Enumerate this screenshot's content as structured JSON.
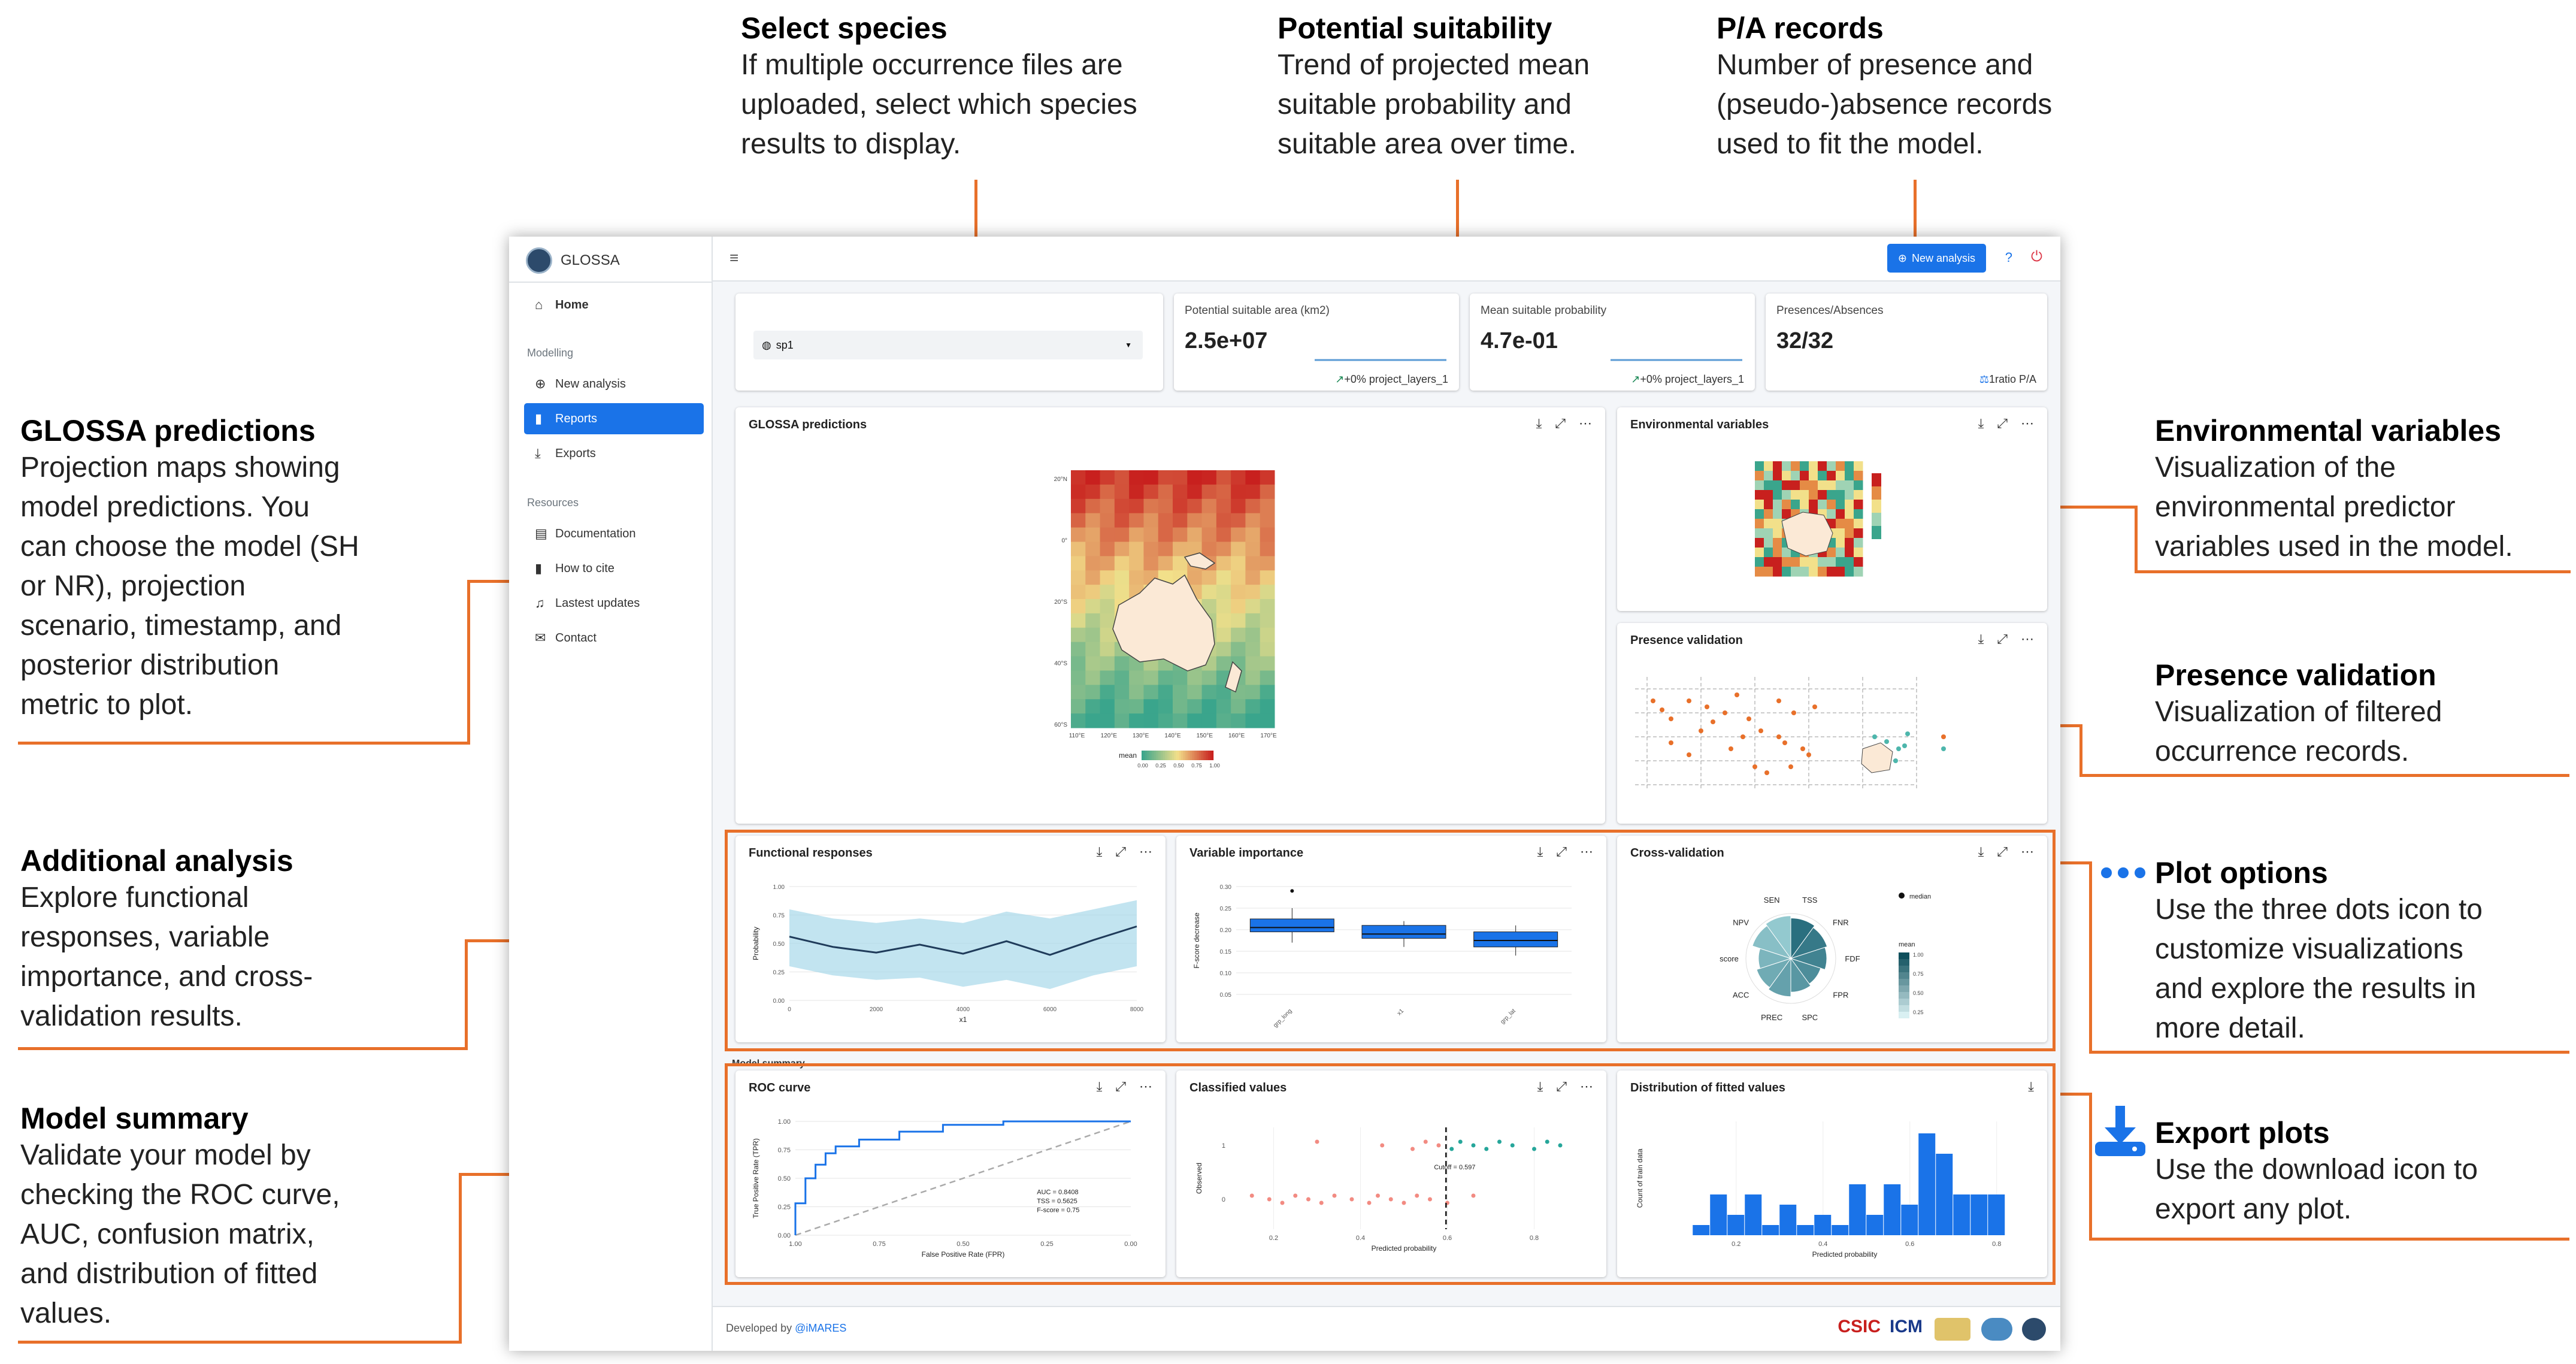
{
  "annotations": {
    "select_species": {
      "title": "Select species",
      "lines": [
        "If multiple occurrence files are",
        "uploaded, select which species",
        "results to display."
      ]
    },
    "potential_suitability": {
      "title": "Potential suitability",
      "lines": [
        "Trend of projected mean",
        "suitable probability and",
        "suitable area over time."
      ]
    },
    "pa_records": {
      "title": "P/A records",
      "lines": [
        "Number of presence and",
        "(pseudo-)absence records",
        "used to fit the model."
      ]
    },
    "glossa_predictions": {
      "title": "GLOSSA predictions",
      "lines": [
        "Projection maps showing",
        "model predictions. You",
        "can choose the model (SH",
        "or NR), projection",
        "scenario, timestamp, and",
        "posterior distribution",
        "metric to plot."
      ]
    },
    "environmental_variables": {
      "title": "Environmental variables",
      "lines": [
        "Visualization of the",
        "environmental predictor",
        "variables used in the model."
      ]
    },
    "presence_validation": {
      "title": "Presence validation",
      "lines": [
        "Visualization of filtered",
        "occurrence records."
      ]
    },
    "additional_analysis": {
      "title": "Additional analysis",
      "lines": [
        "Explore functional",
        "responses, variable",
        "importance, and cross-",
        "validation results."
      ]
    },
    "plot_options": {
      "title": "Plot options",
      "lines": [
        "Use the three dots icon to",
        "customize visualizations",
        "and explore the results in",
        "more detail."
      ]
    },
    "model_summary": {
      "title": "Model summary",
      "lines": [
        "Validate your model by",
        "checking the ROC curve,",
        "AUC, confusion matrix,",
        "and distribution of fitted",
        "values."
      ]
    },
    "export_plots": {
      "title": "Export plots",
      "lines": [
        "Use the download icon to",
        "export any plot."
      ]
    }
  },
  "app": {
    "brand": "GLOSSA",
    "sidebar": {
      "home": "Home",
      "section_modelling": "Modelling",
      "new_analysis": "New analysis",
      "reports": "Reports",
      "exports": "Exports",
      "section_resources": "Resources",
      "documentation": "Documentation",
      "how_to_cite": "How to cite",
      "latest_updates": "Lastest updates",
      "contact": "Contact"
    },
    "topbar": {
      "new_analysis_button": "New analysis",
      "help": "?"
    },
    "species_select": {
      "value": "sp1"
    },
    "value_boxes": [
      {
        "label": "Potential suitable area (km2)",
        "value": "2.5e+07",
        "foot": "+0% project_layers_1"
      },
      {
        "label": "Mean suitable probability",
        "value": "4.7e-01",
        "foot": "+0% project_layers_1"
      },
      {
        "label": "Presences/Absences",
        "value": "32/32",
        "foot": "1ratio P/A"
      }
    ],
    "cards": {
      "predictions": "GLOSSA predictions",
      "env_vars": "Environmental variables",
      "presence_validation": "Presence validation",
      "functional_responses": "Functional responses",
      "variable_importance": "Variable importance",
      "cross_validation": "Cross-validation",
      "model_summary_label": "Model summary",
      "roc_curve": "ROC curve",
      "classified_values": "Classified values",
      "fitted_distribution": "Distribution of fitted values"
    },
    "footer": {
      "developed_by": "Developed by",
      "org": "@iMARES",
      "logo_csic": "CSIC",
      "logo_icm": "ICM"
    }
  },
  "chart_data": [
    {
      "type": "heatmap",
      "title": "GLOSSA predictions",
      "legend_title": "mean",
      "legend_ticks": [
        "0.00",
        "0.25",
        "0.50",
        "0.75",
        "1.00"
      ],
      "x_ticks": [
        "110°E",
        "120°E",
        "130°E",
        "140°E",
        "150°E",
        "160°E",
        "170°E"
      ],
      "y_ticks": [
        "20°N",
        "0°",
        "20°S",
        "40°S",
        "60°S"
      ],
      "colors": {
        "low": "#3aa58c",
        "mid": "#f2e08a",
        "high": "#c8201e"
      }
    },
    {
      "type": "line",
      "title": "Functional responses",
      "xlabel": "x1",
      "ylabel": "Probability",
      "x_ticks": [
        "0",
        "2000",
        "4000",
        "6000",
        "8000"
      ],
      "y_ticks": [
        "0.00",
        "0.25",
        "0.50",
        "0.75",
        "1.00"
      ],
      "xlim": [
        0,
        8000
      ],
      "ylim": [
        0,
        1
      ],
      "x": [
        0,
        1000,
        2000,
        3000,
        4000,
        5000,
        6000,
        7000,
        8000
      ],
      "mean": [
        0.56,
        0.47,
        0.42,
        0.49,
        0.41,
        0.52,
        0.4,
        0.53,
        0.65
      ],
      "lower": [
        0.3,
        0.22,
        0.18,
        0.2,
        0.12,
        0.18,
        0.1,
        0.22,
        0.3
      ],
      "upper": [
        0.8,
        0.72,
        0.68,
        0.72,
        0.68,
        0.78,
        0.72,
        0.8,
        0.88
      ]
    },
    {
      "type": "bar",
      "subtype": "boxplot",
      "title": "Variable importance",
      "ylabel": "F-score decrease",
      "categories": [
        "grp_long",
        "x1",
        "grp_lat"
      ],
      "y_ticks": [
        "0.05",
        "0.10",
        "0.15",
        "0.20",
        "0.25",
        "0.30"
      ],
      "ylim": [
        0.05,
        0.3
      ],
      "boxes": [
        {
          "q1": 0.195,
          "median": 0.205,
          "q3": 0.225,
          "min": 0.17,
          "max": 0.25
        },
        {
          "q1": 0.18,
          "median": 0.19,
          "q3": 0.21,
          "min": 0.16,
          "max": 0.22
        },
        {
          "q1": 0.16,
          "median": 0.175,
          "q3": 0.195,
          "min": 0.14,
          "max": 0.21
        }
      ],
      "outliers": [
        {
          "category": "grp_long",
          "value": 0.29
        }
      ]
    },
    {
      "type": "bar",
      "subtype": "polar",
      "title": "Cross-validation",
      "categories": [
        "TSS",
        "FNR",
        "FDF",
        "FPR",
        "SPC",
        "PREC",
        "ACC",
        "score",
        "NPV",
        "SEN"
      ],
      "legend": [
        "median",
        "mean"
      ],
      "legend_ticks": [
        "1.00",
        "0.75",
        "0.50",
        "0.25"
      ]
    },
    {
      "type": "line",
      "title": "ROC curve",
      "xlabel": "False Positive Rate (FPR)",
      "ylabel": "True Positive Rate (TPR)",
      "x_ticks": [
        "1.00",
        "0.75",
        "0.50",
        "0.25",
        "0.00"
      ],
      "y_ticks": [
        "0.00",
        "0.25",
        "0.50",
        "0.75",
        "1.00"
      ],
      "annotation": [
        "AUC = 0.8408",
        "TSS = 0.5625",
        "F-score = 0.75"
      ],
      "fpr": [
        0,
        0,
        0.03,
        0.03,
        0.06,
        0.06,
        0.09,
        0.09,
        0.12,
        0.12,
        0.19,
        0.19,
        0.31,
        0.31,
        0.44,
        0.44,
        0.62,
        0.62,
        1.0
      ],
      "tpr": [
        0,
        0.28,
        0.28,
        0.5,
        0.5,
        0.62,
        0.62,
        0.72,
        0.72,
        0.78,
        0.78,
        0.84,
        0.84,
        0.91,
        0.91,
        0.97,
        0.97,
        1.0,
        1.0
      ]
    },
    {
      "type": "scatter",
      "title": "Classified values",
      "xlabel": "Predicted probability",
      "ylabel": "Observed",
      "x_ticks": [
        "0.2",
        "0.4",
        "0.6",
        "0.8"
      ],
      "y_ticks": [
        "0",
        "1"
      ],
      "cutoff_label": "Cutoff = 0.597",
      "cutoff": 0.597,
      "xlim": [
        0.1,
        0.9
      ],
      "absence_x": [
        0.15,
        0.19,
        0.22,
        0.25,
        0.28,
        0.31,
        0.34,
        0.38,
        0.42,
        0.44,
        0.47,
        0.5,
        0.53,
        0.56,
        0.6,
        0.66
      ],
      "presence_x": [
        0.3,
        0.45,
        0.52,
        0.55,
        0.58,
        0.61,
        0.63,
        0.66,
        0.69,
        0.72,
        0.75,
        0.8,
        0.83,
        0.86
      ]
    },
    {
      "type": "bar",
      "title": "Distribution of fitted values",
      "xlabel": "Predicted probability",
      "ylabel": "Count of train data",
      "x_ticks": [
        "0.2",
        "0.4",
        "0.6",
        "0.8"
      ],
      "bins": [
        0.1,
        0.14,
        0.18,
        0.22,
        0.26,
        0.3,
        0.34,
        0.38,
        0.42,
        0.46,
        0.5,
        0.54,
        0.58,
        0.62,
        0.66,
        0.7,
        0.74,
        0.78
      ],
      "values": [
        1,
        4,
        2,
        4,
        1,
        3,
        1,
        2,
        1,
        5,
        2,
        5,
        3,
        10,
        8,
        4,
        4,
        4
      ]
    }
  ]
}
